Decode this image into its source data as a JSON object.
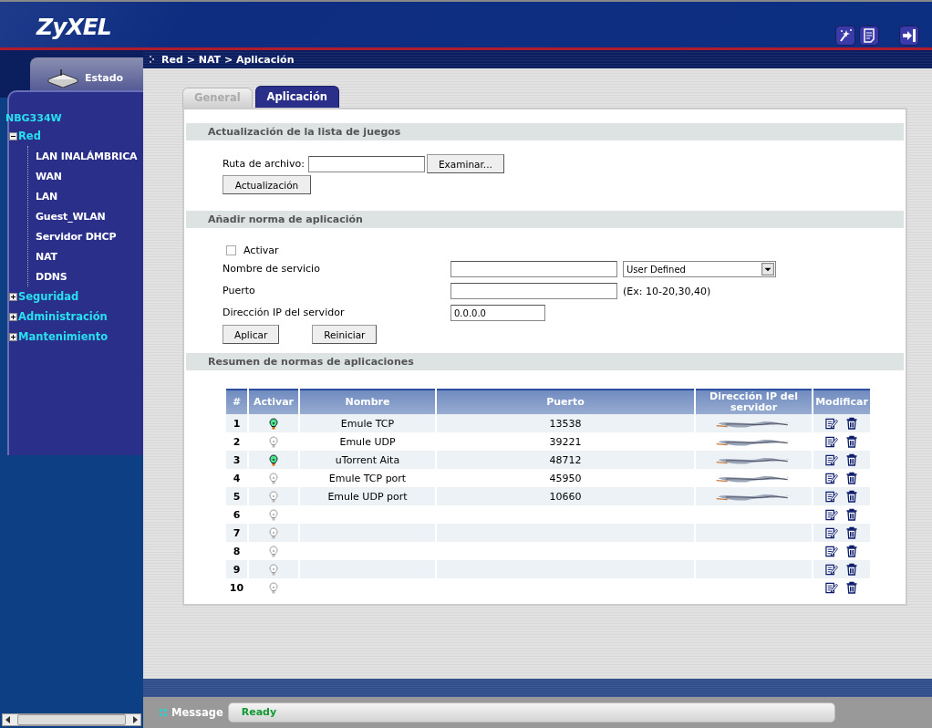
{
  "header": {
    "logo": "ZyXEL"
  },
  "breadcrumb": "Red > NAT > Aplicación",
  "sidebar": {
    "status_tab": "Estado",
    "device": "NBG334W",
    "items": [
      {
        "label": "Red",
        "expanded": true,
        "children": [
          {
            "label": "LAN INALÁMBRICA"
          },
          {
            "label": "WAN"
          },
          {
            "label": "LAN"
          },
          {
            "label": "Guest_WLAN"
          },
          {
            "label": "Servidor DHCP"
          },
          {
            "label": "NAT"
          },
          {
            "label": "DDNS"
          }
        ]
      },
      {
        "label": "Seguridad",
        "expanded": false
      },
      {
        "label": "Administración",
        "expanded": false
      },
      {
        "label": "Mantenimiento",
        "expanded": false
      }
    ]
  },
  "tabs": [
    {
      "label": "General",
      "selected": false
    },
    {
      "label": "Aplicación",
      "selected": true
    }
  ],
  "update_section": {
    "title": "Actualización de la lista de juegos",
    "file_label": "Ruta de archivo:",
    "browse_button": "Examinar...",
    "update_button": "Actualización"
  },
  "add_section": {
    "title": "Añadir norma de aplicación",
    "activate": {
      "label": "Activar",
      "checked": false
    },
    "service_label": "Nombre de servicio",
    "service_select": "User Defined",
    "port_label": "Puerto",
    "port_hint": "(Ex: 10-20,30,40)",
    "ip_label": "Dirección IP del servidor",
    "ip_value": "0.0.0.0",
    "apply_button": "Aplicar",
    "reset_button": "Reiniciar"
  },
  "summary_section": {
    "title": "Resumen de normas de aplicaciones",
    "columns": [
      "#",
      "Activar",
      "Nombre",
      "Puerto",
      "Dirección IP del servidor",
      "Modificar"
    ],
    "rows": [
      {
        "number": "1",
        "active": true,
        "name": "Emule TCP",
        "port": "13538",
        "ip_redacted": true
      },
      {
        "number": "2",
        "active": false,
        "name": "Emule UDP",
        "port": "39221",
        "ip_redacted": true
      },
      {
        "number": "3",
        "active": true,
        "name": "uTorrent Aita",
        "port": "48712",
        "ip_redacted": true
      },
      {
        "number": "4",
        "active": false,
        "name": "Emule TCP port",
        "port": "45950",
        "ip_redacted": true
      },
      {
        "number": "5",
        "active": false,
        "name": "Emule UDP port",
        "port": "10660",
        "ip_redacted": true
      },
      {
        "number": "6",
        "active": false
      },
      {
        "number": "7",
        "active": false
      },
      {
        "number": "8",
        "active": false
      },
      {
        "number": "9",
        "active": false
      },
      {
        "number": "10",
        "active": false
      }
    ]
  },
  "status_bar": {
    "label": "Message",
    "value": "Ready"
  }
}
